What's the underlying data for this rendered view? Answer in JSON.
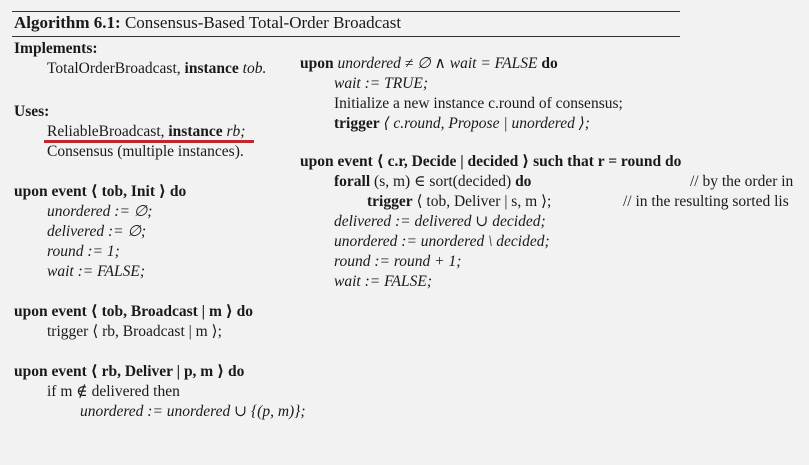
{
  "title": {
    "label": "Algorithm 6.1:",
    "name": "Consensus-Based Total-Order Broadcast"
  },
  "implements": {
    "heading": "Implements:",
    "module": "TotalOrderBroadcast,",
    "instance_kw": "instance",
    "instance_name": "tob."
  },
  "uses": {
    "heading": "Uses:",
    "rb_module": "ReliableBroadcast,",
    "instance_kw": "instance",
    "rb_name": "rb;",
    "consensus": "Consensus (multiple instances)."
  },
  "left": {
    "init_head": "upon event ⟨ tob, Init ⟩ do",
    "init_1": "unordered := ∅;",
    "init_2": "delivered := ∅;",
    "init_3": "round := 1;",
    "init_4": "wait := FALSE;",
    "bcast_head": "upon event ⟨ tob, Broadcast | m ⟩ do",
    "bcast_1": "trigger ⟨ rb, Broadcast | m ⟩;",
    "deliver_head": "upon event ⟨ rb, Deliver | p, m ⟩ do",
    "deliver_1": "if m ∉ delivered then",
    "deliver_2": "unordered := unordered ∪ {(p, m)};"
  },
  "right": {
    "unordered_head_kw": "upon",
    "unordered_head_cond": "unordered ≠ ∅ ∧ wait = FALSE",
    "unordered_head_do": "do",
    "u_1": "wait := TRUE;",
    "u_2": "Initialize a new instance c.round of consensus;",
    "u_3_kw": "trigger",
    "u_3": "⟨ c.round, Propose | unordered ⟩;",
    "decide_head": "upon event ⟨ c.r, Decide | decided ⟩ such that r = round do",
    "d_forall_kw": "forall",
    "d_forall": "(s, m) ∈ sort(decided)",
    "d_forall_do": "do",
    "d_comment_1": "// by the order in",
    "d_trigger_kw": "trigger",
    "d_trigger": "⟨ tob, Deliver | s, m ⟩;",
    "d_comment_2": "// in the resulting sorted lis",
    "d_1": "delivered := delivered ∪ decided;",
    "d_2": "unordered := unordered \\ decided;",
    "d_3": "round := round + 1;",
    "d_4": "wait := FALSE;"
  },
  "colors": {
    "highlight": "#c0262d"
  }
}
